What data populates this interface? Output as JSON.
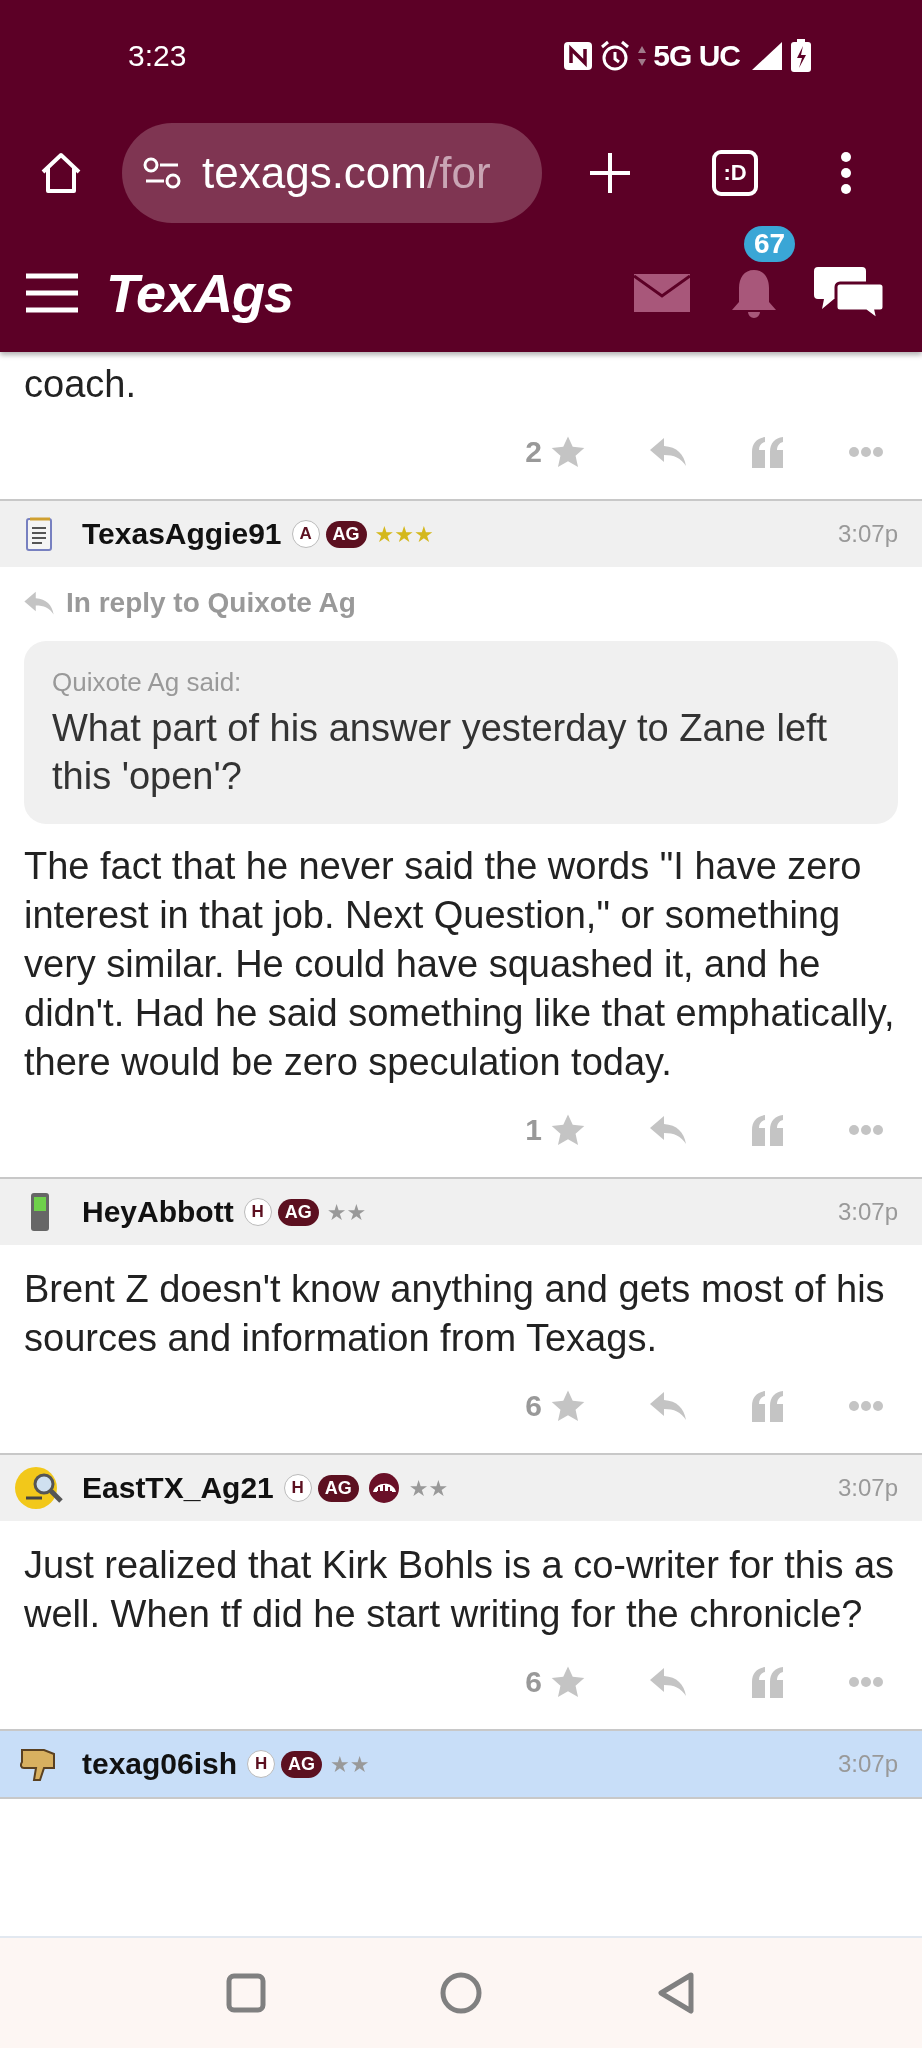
{
  "status_bar": {
    "time": "3:23",
    "network": "5G UC"
  },
  "browser": {
    "url_host": "texags.com",
    "url_path": "/for",
    "tab_switcher": ":D"
  },
  "site_header": {
    "logo": "TexAgs",
    "notification_count": "67"
  },
  "previous_post": {
    "body_tail": "coach.",
    "star_count": "2"
  },
  "posts": [
    {
      "kind": "notepad",
      "username": "TexasAggie91",
      "badges": [
        {
          "kind": "letter",
          "text": "A"
        },
        {
          "kind": "tag",
          "text": "AG"
        }
      ],
      "rank": "★★★",
      "color": "#d4b81c",
      "time": "3:07p",
      "highlighted": false,
      "reply_to": "In reply to Quixote Ag",
      "quote": {
        "author": "Quixote Ag said:",
        "text": "What part of his answer yesterday to Zane left this 'open'?"
      },
      "body": "The fact that he never said the words \"I have zero interest in that job. Next Question,\" or something very similar. He could have squashed it, and he didn't. Had he said something like that emphatically, there would be zero speculation today.",
      "star_count": "1"
    },
    {
      "kind": "phone",
      "username": "HeyAbbott",
      "badges": [
        {
          "kind": "letter",
          "text": "H"
        },
        {
          "kind": "tag",
          "text": "AG"
        }
      ],
      "rank": "★★",
      "color": "#999999",
      "time": "3:07p",
      "highlighted": false,
      "body": "Brent Z doesn't know anything and gets most of his sources and information from Texags.",
      "star_count": "6"
    },
    {
      "kind": "face",
      "username": "EastTX_Ag21",
      "badges": [
        {
          "kind": "letter",
          "text": "H"
        },
        {
          "kind": "tag",
          "text": "AG"
        },
        {
          "kind": "emblem"
        }
      ],
      "rank": "★★",
      "color": "#999999",
      "time": "3:07p",
      "highlighted": false,
      "body": "Just realized that Kirk Bohls is a co-writer for this as well. When tf did he start writing for the chronicle?",
      "star_count": "6"
    },
    {
      "kind": "hand",
      "username": "texag06ish",
      "badges": [
        {
          "kind": "letter",
          "text": "H"
        },
        {
          "kind": "tag",
          "text": "AG"
        }
      ],
      "rank": "★★",
      "color": "#999999",
      "time": "3:07p",
      "highlighted": true
    }
  ]
}
